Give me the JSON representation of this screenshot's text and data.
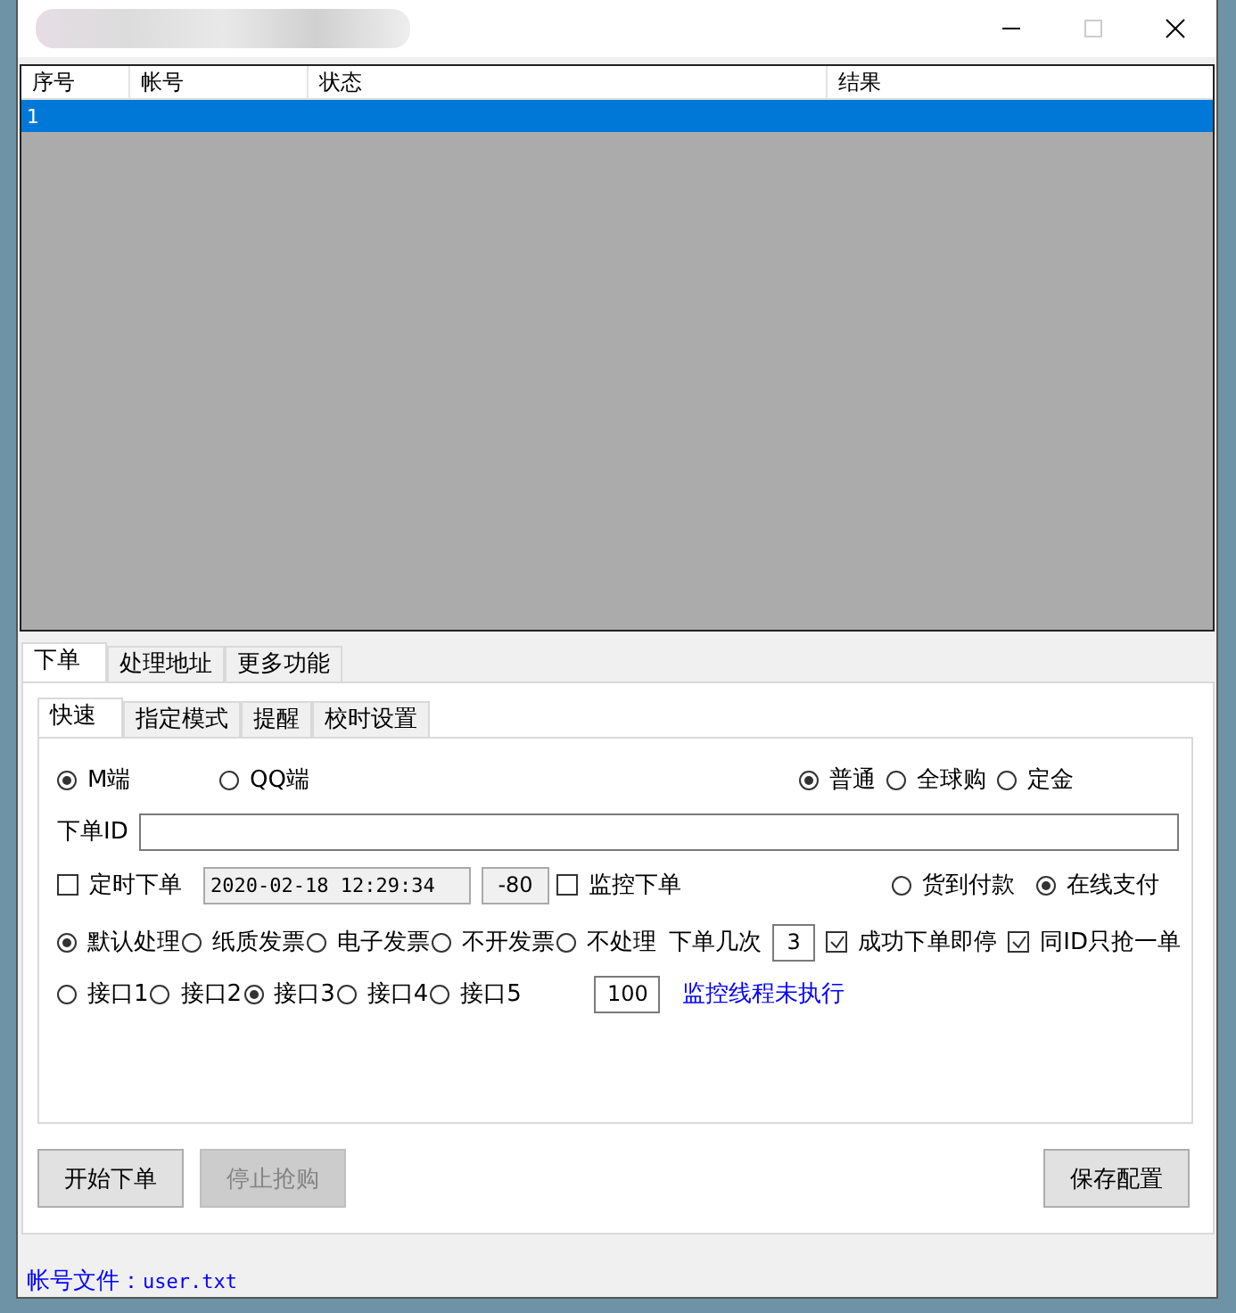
{
  "table": {
    "columns": [
      "序号",
      "帐号",
      "状态",
      "结果"
    ],
    "rows": [
      {
        "cells": [
          "1"
        ],
        "selected": true
      }
    ]
  },
  "tabs": [
    {
      "label": "下单",
      "selected": true
    },
    {
      "label": "处理地址",
      "selected": false
    },
    {
      "label": "更多功能",
      "selected": false
    }
  ],
  "subtabs": [
    {
      "label": "快速",
      "selected": true
    },
    {
      "label": "指定模式",
      "selected": false
    },
    {
      "label": "提醒",
      "selected": false
    },
    {
      "label": "校时设置",
      "selected": false
    }
  ],
  "client_options": [
    {
      "label": "M端",
      "selected": true
    },
    {
      "label": "QQ端",
      "selected": false
    }
  ],
  "order_types": [
    {
      "label": "普通",
      "selected": true
    },
    {
      "label": "全球购",
      "selected": false
    },
    {
      "label": "定金",
      "selected": false
    }
  ],
  "order_id": {
    "label": "下单ID"
  },
  "timed_order": {
    "label": "定时下单",
    "checked": false
  },
  "time_value": "2020-02-18 12:29:34",
  "offset_value": "-80",
  "monitor_order": {
    "label": "监控下单",
    "checked": false
  },
  "payment": [
    {
      "label": "货到付款",
      "selected": false
    },
    {
      "label": "在线支付",
      "selected": true
    }
  ],
  "invoice": [
    {
      "label": "默认处理",
      "selected": true
    },
    {
      "label": "纸质发票",
      "selected": false
    },
    {
      "label": "电子发票",
      "selected": false
    },
    {
      "label": "不开发票",
      "selected": false
    },
    {
      "label": "不处理",
      "selected": false
    }
  ],
  "order_count": {
    "label": "下单几次",
    "value": "3"
  },
  "checks": [
    {
      "label": "成功下单即停",
      "checked": true
    },
    {
      "label": "同ID只抢一单",
      "checked": true
    }
  ],
  "ports": [
    {
      "label": "接口1",
      "selected": false
    },
    {
      "label": "接口2",
      "selected": false
    },
    {
      "label": "接口3",
      "selected": true
    },
    {
      "label": "接口4",
      "selected": false
    },
    {
      "label": "接口5",
      "selected": false
    }
  ],
  "thread_value": "100",
  "status_link": "监控线程未执行",
  "buttons": [
    {
      "label": "开始下单",
      "disabled": false
    },
    {
      "label": "停止抢购",
      "disabled": true
    },
    {
      "label": "保存配置",
      "disabled": false
    }
  ],
  "footer": {
    "label": "帐号文件：",
    "file": "user.txt"
  }
}
